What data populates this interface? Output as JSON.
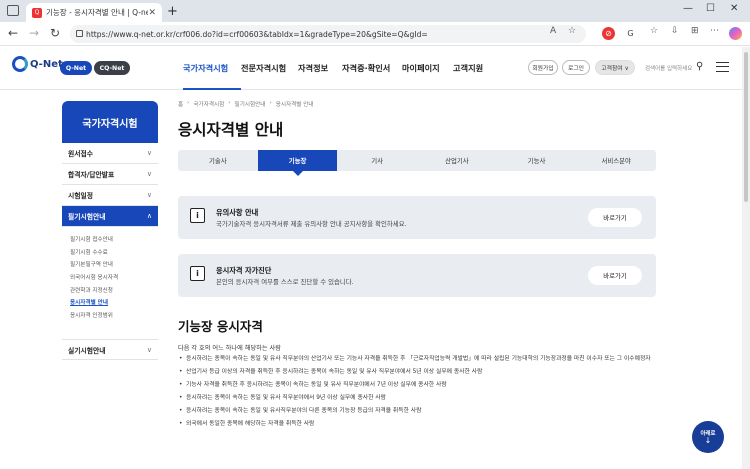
{
  "browser": {
    "tab_title": "기능장 - 응시자격별 안내 | Q-net",
    "favicon": "Q",
    "new_tab": "+",
    "url": "https://www.q-net.or.kr/crf006.do?id=crf00603&tabIdx=1&gradeType=20&gSite=Q&gId="
  },
  "header": {
    "logo_text": "Q-Net",
    "service_buttons": [
      "Q-Net",
      "CQ-Net"
    ],
    "gnb": [
      "국가자격시험",
      "전문자격시험",
      "자격정보",
      "자격증·확인서",
      "마이페이지",
      "고객지원"
    ],
    "gnb_active_index": 0,
    "buttons": {
      "join": "회원가입",
      "login": "로그인",
      "scope": "고객참여 ∨"
    },
    "search_placeholder": "검색어를 입력하세요"
  },
  "sidebar": {
    "title": "국가자격시험",
    "items": [
      {
        "label": "원서접수"
      },
      {
        "label": "합격자/답안발표"
      },
      {
        "label": "시험일정"
      },
      {
        "label": "필기시험안내"
      }
    ],
    "subitems": [
      "필기시험 접수안내",
      "필기시험 수수료",
      "필기본필구역 안내",
      "외국어시험 응시자격",
      "관련학과 지정신청",
      "응시자격별 안내",
      "응시자격 인정범위"
    ],
    "current_sub_index": 5,
    "last_item": "실기시험안내"
  },
  "breadcrumb": [
    "홈",
    "국가자격시험",
    "필기시험안내",
    "응시자격별 안내"
  ],
  "page_title": "응시자격별 안내",
  "tabs": [
    "기술사",
    "기능장",
    "기사",
    "산업기사",
    "기능사",
    "서비스분야"
  ],
  "tabs_active_index": 1,
  "cards": [
    {
      "title": "유의사항 안내",
      "desc": "국가기술자격 응시자격서류 제출 유의사항 안내 공지사항을 확인하세요.",
      "button": "바로가기"
    },
    {
      "title": "응시자격 자가진단",
      "desc": "본인의 응시자격 여부를 스스로 진단할 수 있습니다.",
      "button": "바로가기"
    }
  ],
  "section": {
    "title": "기능장 응시자격",
    "intro": "다음 각 호의 어느 하나에 해당하는 사람",
    "requirements": [
      "응시하려는 종목이 속하는 동일 및 유사 직무분야의 산업기사 또는 기능사 자격을 취득한 후 「근로자직업능력 개발법」에 따라 설립된 기능대학의 기능장과정을 마친 이수자 또는 그 이수예정자",
      "산업기사 등급 이상의 자격을 취득한 후 응시하려는 종목이 속하는 동일 및 유사 직무분야에서 5년 이상 실무에 종사한 사람",
      "기능사 자격을 취득한 후 응시하려는 종목이 속하는 동일 및 유사 직무분야에서 7년 이상 실무에 종사한 사람",
      "응시하려는 종목이 속하는 동일 및 유사 직무분야에서 9년 이상 실무에 종사한 사람",
      "응시하려는 종목이 속하는 동일 및 유사직무분야의 다른 종목의 기능장 등급의 자격을 취득한 사람",
      "외국에서 동일한 종목에 해당하는 자격을 취득한 사람"
    ]
  },
  "float_button": {
    "label": "아래로",
    "arrow": "↓"
  },
  "colors": {
    "primary": "#1747b9",
    "accent": "#1a53c4",
    "card_bg": "#e9ecf1"
  },
  "icons": [
    "sidebar-toggle-icon",
    "close-icon",
    "back-icon",
    "forward-icon",
    "refresh-icon",
    "lock-icon",
    "info-icon",
    "search-icon",
    "menu-icon",
    "chevron-down-icon",
    "chevron-up-icon"
  ]
}
